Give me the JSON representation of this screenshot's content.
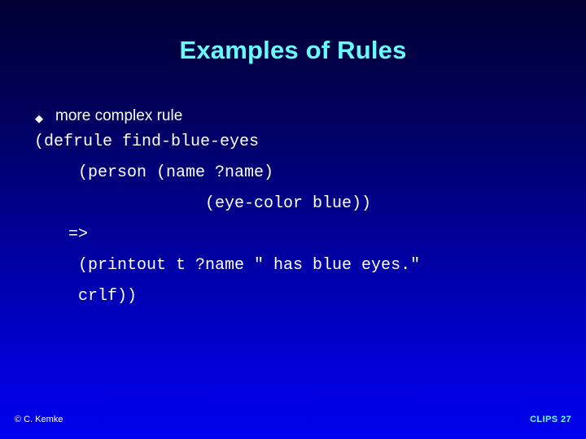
{
  "slide": {
    "title": "Examples of Rules",
    "bullet": {
      "marker": "◆",
      "text": "more complex rule"
    },
    "code_lines": [
      "(defrule find-blue-eyes",
      "(person (name ?name)",
      "(eye-color blue))",
      "=>",
      "(printout t ?name \" has blue eyes.\"",
      "crlf))"
    ],
    "footer": {
      "copyright": "© C. Kemke",
      "course": "CLIPS",
      "page": "27"
    },
    "colors": {
      "title": "#66ffff",
      "body": "#ffffff",
      "accent": "#66ffff",
      "bg_top": "#000033",
      "bg_bottom": "#0000ee"
    }
  }
}
